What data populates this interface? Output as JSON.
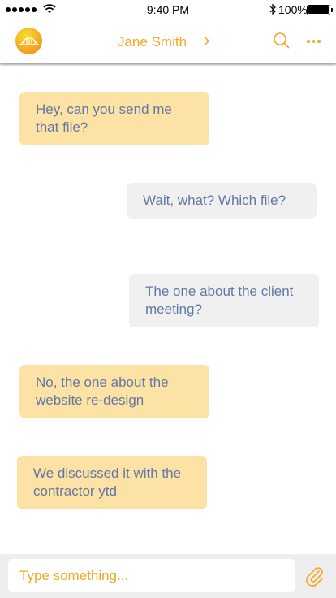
{
  "status": {
    "time": "9:40 PM",
    "battery": "100%"
  },
  "header": {
    "contact_name": "Jane Smith",
    "accent": "#f5a623"
  },
  "icons": {
    "avatar": "bridge-logo-icon",
    "chevron": "chevron-right-icon",
    "search": "search-icon",
    "more": "more-dots-icon",
    "attach": "paperclip-icon"
  },
  "messages": [
    {
      "side": "in",
      "text": "Hey, can you send me that file?"
    },
    {
      "side": "out",
      "text": "Wait, what? Which file?"
    },
    {
      "side": "out",
      "text": "The one about the client meeting?"
    },
    {
      "side": "in",
      "text": "No, the one about the website re-design"
    },
    {
      "side": "in",
      "text": "We discussed it with the contractor ytd"
    }
  ],
  "composer": {
    "placeholder": "Type something..."
  },
  "colors": {
    "incoming_bubble": "#fde2a6",
    "outgoing_bubble": "#f0f0f0",
    "message_text": "#6378a2"
  }
}
